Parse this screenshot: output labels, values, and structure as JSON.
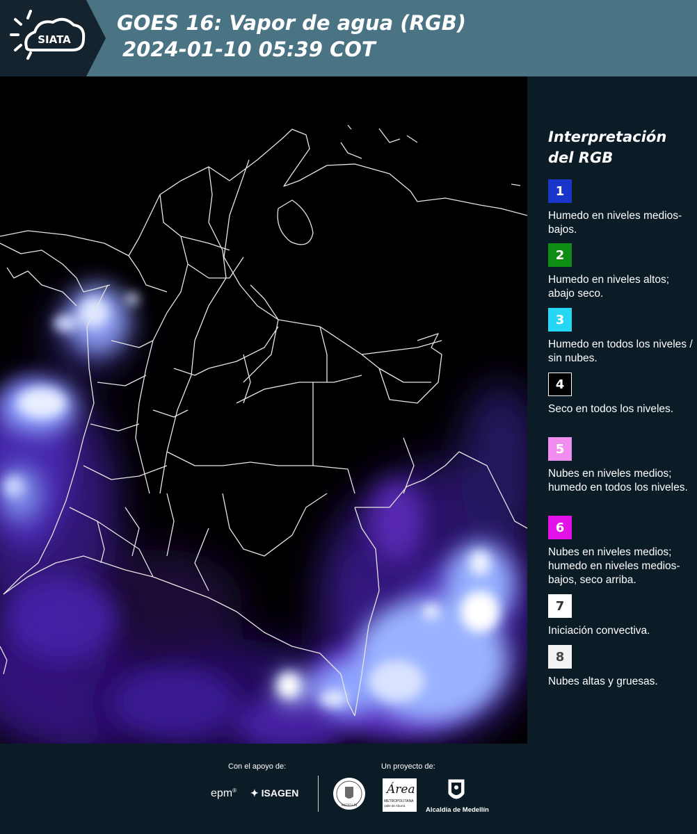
{
  "header": {
    "logo_text": "SIATA",
    "title_line1": "GOES 16: Vapor de agua (RGB)",
    "title_line2": "2024-01-10 05:39 COT",
    "background_color": "#4a7384"
  },
  "map": {
    "description_icon": "satellite-water-vapor-map"
  },
  "legend": {
    "title": "Interpretación del RGB",
    "items": [
      {
        "number": "1",
        "color": "#1a35c9",
        "text": "Humedo en niveles medios-bajos."
      },
      {
        "number": "2",
        "color": "#0f8c12",
        "text": "Humedo en niveles altos; abajo seco."
      },
      {
        "number": "3",
        "color": "#27d6f2",
        "text": "Humedo en todos los niveles / sin nubes."
      },
      {
        "number": "4",
        "color": "#000000",
        "text": "Seco en todos los niveles."
      },
      {
        "number": "5",
        "color": "#f08ef0",
        "text": "Nubes en niveles medios; humedo en todos los niveles."
      },
      {
        "number": "6",
        "color": "#e211e8",
        "text": "Nubes en niveles medios; humedo en niveles medios-bajos, seco arriba."
      },
      {
        "number": "7",
        "color": "#ffffff",
        "text": "Iniciación convectiva."
      },
      {
        "number": "8",
        "color": "#f2f2f2",
        "text": "Nubes altas y gruesas."
      }
    ]
  },
  "footer": {
    "support_label": "Con el apoyo de:",
    "project_label": "Un proyecto de:",
    "epm": "epm",
    "isagen": "ISAGEN",
    "area_metro": "Área",
    "area_metro_sub": "METROPOLITANA",
    "area_metro_sub2": "Valle de Aburrá",
    "alcaldia": "Alcaldía de Medellín",
    "seal_text": "MEDELLÍN"
  }
}
